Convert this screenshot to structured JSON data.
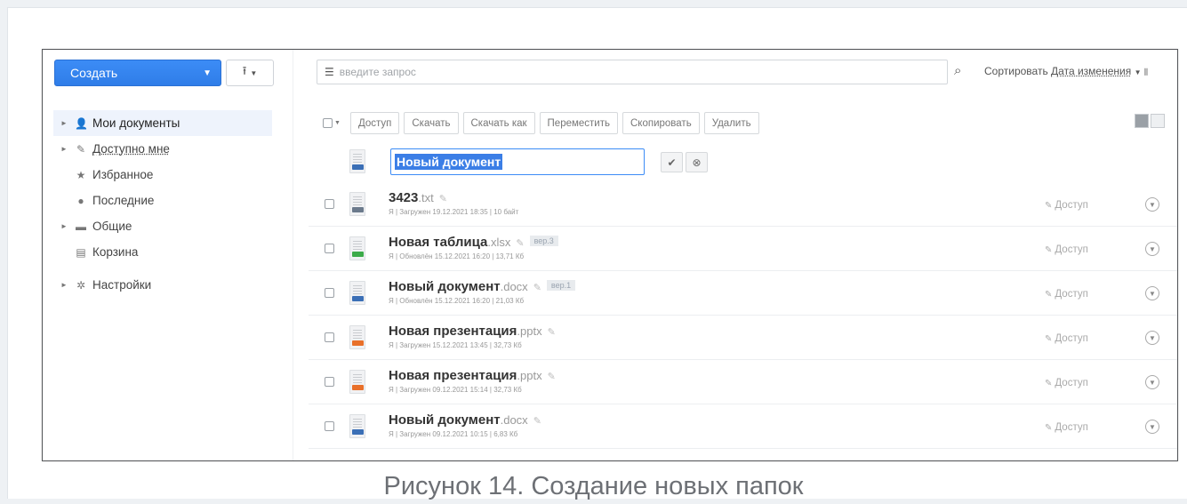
{
  "sidebar": {
    "create_label": "Создать",
    "upload_icon": "upload-icon",
    "items": [
      {
        "label": "Мои документы",
        "icon": "person-icon",
        "arrow": true,
        "active": true,
        "underline": false
      },
      {
        "label": "Доступно мне",
        "icon": "share-icon",
        "arrow": true,
        "active": false,
        "underline": true
      },
      {
        "label": "Избранное",
        "icon": "star-icon",
        "arrow": false,
        "active": false,
        "underline": false
      },
      {
        "label": "Последние",
        "icon": "clock-icon",
        "arrow": false,
        "active": false,
        "underline": false
      },
      {
        "label": "Общие",
        "icon": "folder-icon",
        "arrow": true,
        "active": false,
        "underline": false
      },
      {
        "label": "Корзина",
        "icon": "trash-icon",
        "arrow": false,
        "active": false,
        "underline": false
      }
    ],
    "settings_label": "Настройки"
  },
  "search": {
    "placeholder": "введите запрос"
  },
  "sort": {
    "label": "Сортировать",
    "value": "Дата изменения"
  },
  "toolbar": {
    "buttons": [
      "Доступ",
      "Скачать",
      "Скачать как",
      "Переместить",
      "Скопировать",
      "Удалить"
    ]
  },
  "new_item": {
    "value": "Новый документ"
  },
  "files": [
    {
      "name": "3423",
      "ext": ".txt",
      "meta": "Я | Загружен 19.12.2021 18:35 | 10 байт",
      "version": "",
      "type_color": "#6b7a8c",
      "access": "Доступ"
    },
    {
      "name": "Новая таблица",
      "ext": ".xlsx",
      "meta": "Я | Обновлён 15.12.2021 16:20 | 13,71 Кб",
      "version": "вер.3",
      "type_color": "#3cab4a",
      "access": "Доступ"
    },
    {
      "name": "Новый документ",
      "ext": ".docx",
      "meta": "Я | Обновлён 15.12.2021 16:20 | 21,03 Кб",
      "version": "вер.1",
      "type_color": "#3b6fb6",
      "access": "Доступ"
    },
    {
      "name": "Новая презентация",
      "ext": ".pptx",
      "meta": "Я | Загружен 15.12.2021 13:45 | 32,73 Кб",
      "version": "",
      "type_color": "#e8702a",
      "access": "Доступ"
    },
    {
      "name": "Новая презентация",
      "ext": ".pptx",
      "meta": "Я | Загружен 09.12.2021 15:14 | 32,73 Кб",
      "version": "",
      "type_color": "#e8702a",
      "access": "Доступ"
    },
    {
      "name": "Новый документ",
      "ext": ".docx",
      "meta": "Я | Загружен 09.12.2021 10:15 | 6,83 Кб",
      "version": "",
      "type_color": "#3b6fb6",
      "access": "Доступ"
    }
  ],
  "caption": "Рисунок 14. Создание новых папок"
}
